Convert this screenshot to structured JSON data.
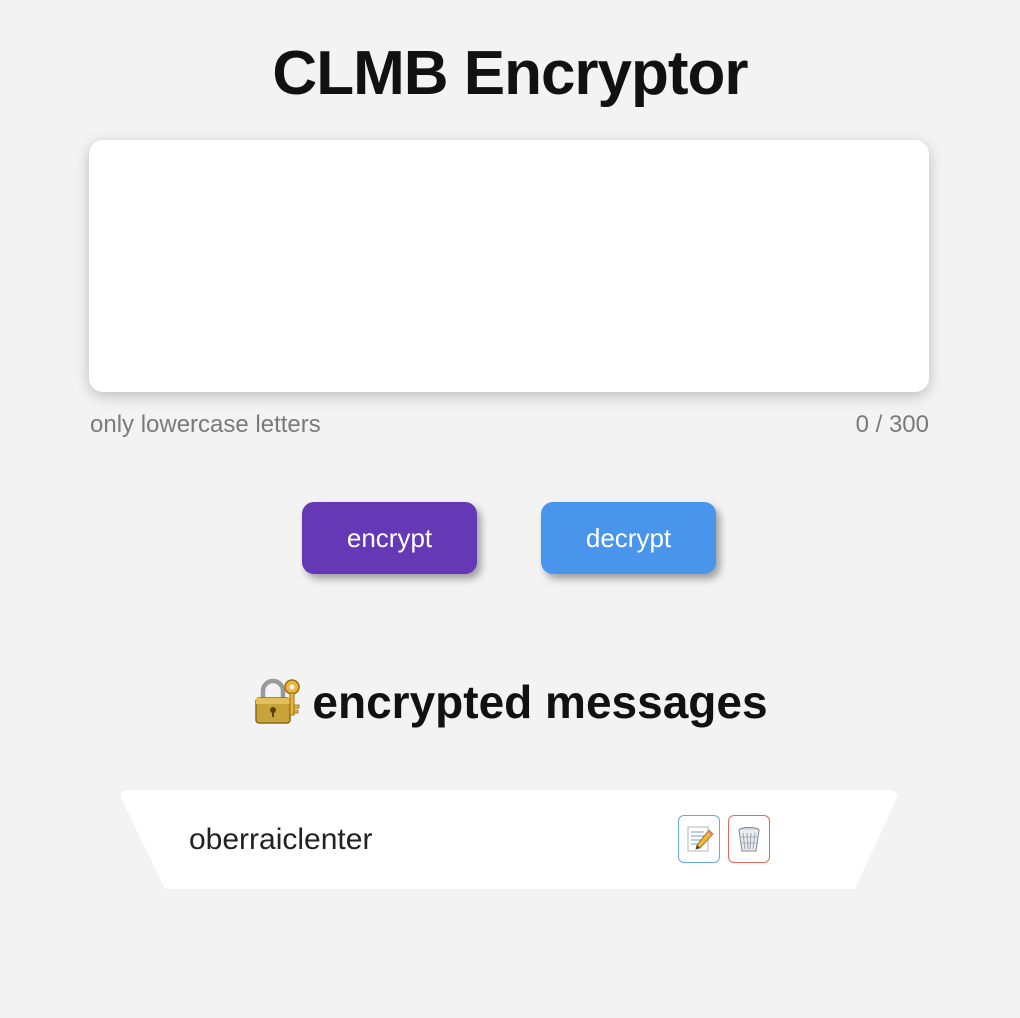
{
  "header": {
    "title": "CLMB Encryptor"
  },
  "input": {
    "value": "",
    "placeholder": "",
    "hint": "only lowercase letters",
    "counter": "0 / 300"
  },
  "actions": {
    "encrypt_label": "encrypt",
    "decrypt_label": "decrypt",
    "encrypt_color": "#6538b5",
    "decrypt_color": "#4a95ec"
  },
  "messages": {
    "heading": "encrypted messages",
    "heading_icon": "locked-with-key-icon",
    "items": [
      {
        "text": "oberraiclenter",
        "edit_icon": "memo-pencil-icon",
        "delete_icon": "wastebasket-icon"
      }
    ]
  }
}
